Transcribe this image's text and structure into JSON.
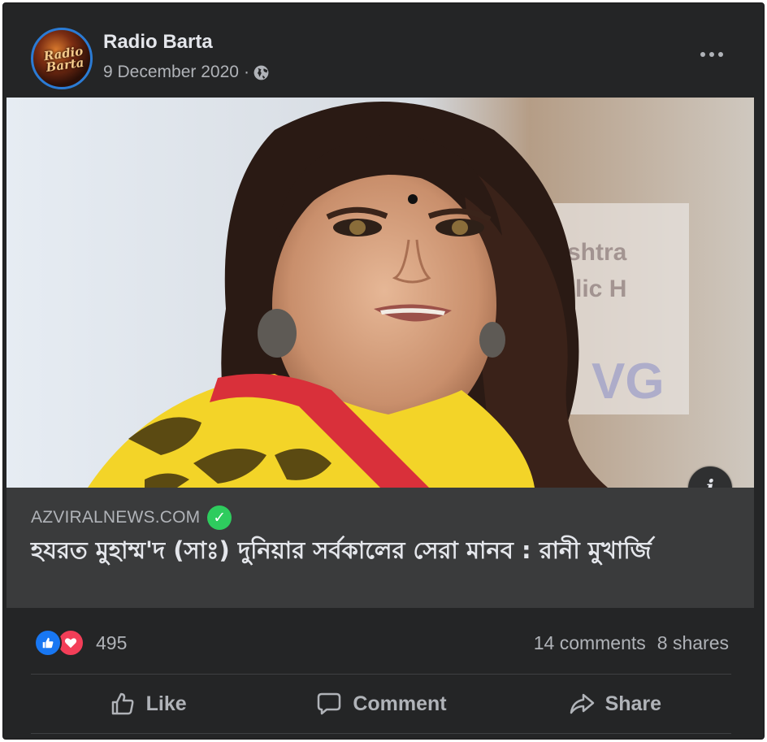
{
  "post": {
    "page_name": "Radio Barta",
    "date": "9 December 2020",
    "separator": "·",
    "avatar_text": "Radio Barta",
    "privacy_icon": "globe-icon",
    "menu_icon": "more-horizontal-icon"
  },
  "link_preview": {
    "domain": "AZVIRALNEWS.COM",
    "verified_icon": "check-circle-icon",
    "headline": "হযরত মুহাম্ম'দ (সাঃ) দুনিয়ার সর্বকালের সেরা মানব : রানী মুখার্জি",
    "info_label": "i",
    "image_alt": "Photo of a woman with long dark hair wearing a yellow outfit with red border"
  },
  "engagement": {
    "reaction_count": "495",
    "comments": "14 comments",
    "shares": "8 shares",
    "reaction_icons": [
      "like-icon",
      "love-icon"
    ]
  },
  "actions": [
    {
      "label": "Like",
      "icon": "thumbs-up-icon"
    },
    {
      "label": "Comment",
      "icon": "comment-icon"
    },
    {
      "label": "Share",
      "icon": "share-icon"
    }
  ],
  "colors": {
    "card_bg": "#242526",
    "link_bg": "#3a3b3c",
    "text_primary": "#e4e6eb",
    "text_secondary": "#b0b3b8",
    "like_blue": "#1877f2",
    "love_red": "#f33e58",
    "verified_green": "#2ecc5e"
  }
}
